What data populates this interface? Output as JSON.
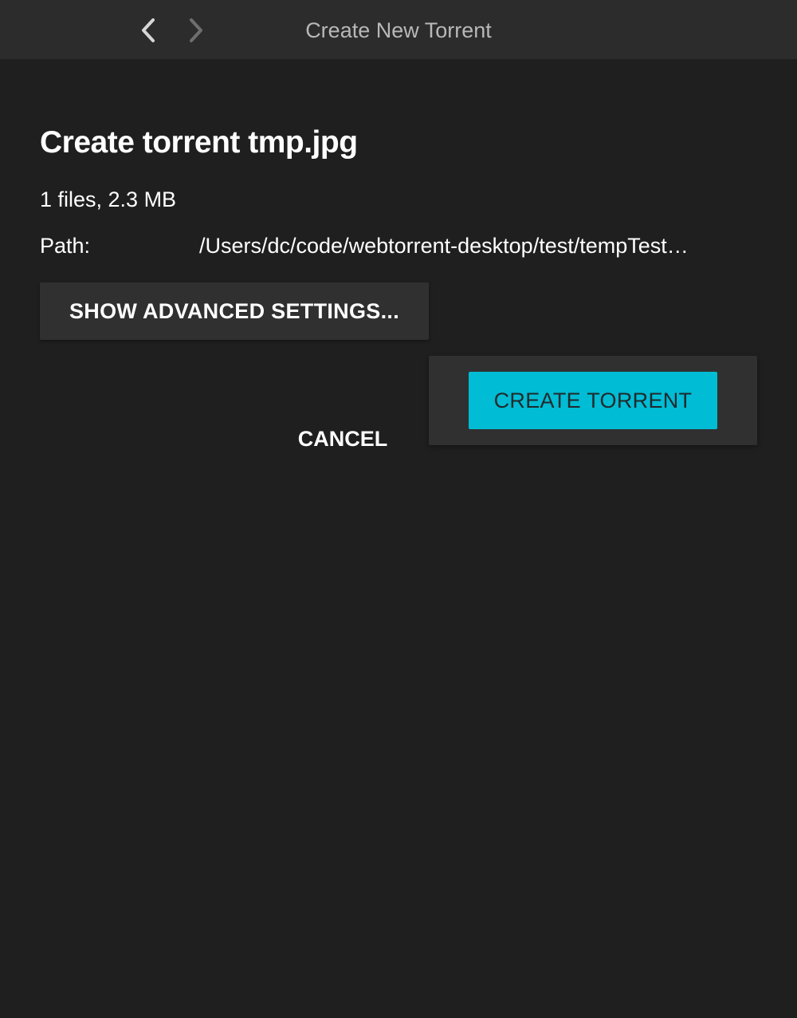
{
  "header": {
    "title": "Create New Torrent",
    "back_icon": "chevron-left-icon",
    "forward_icon": "chevron-right-icon"
  },
  "main": {
    "page_title": "Create torrent tmp.jpg",
    "file_summary": "1 files, 2.3 MB",
    "path_label": "Path:",
    "path_value": "/Users/dc/code/webtorrent-desktop/test/tempTest…"
  },
  "actions": {
    "advanced_label": "SHOW ADVANCED SETTINGS...",
    "cancel_label": "CANCEL",
    "create_label": "CREATE TORRENT"
  },
  "colors": {
    "accent": "#00bcd4",
    "background": "#1f1f1f",
    "header_background": "#2c2c2c"
  }
}
